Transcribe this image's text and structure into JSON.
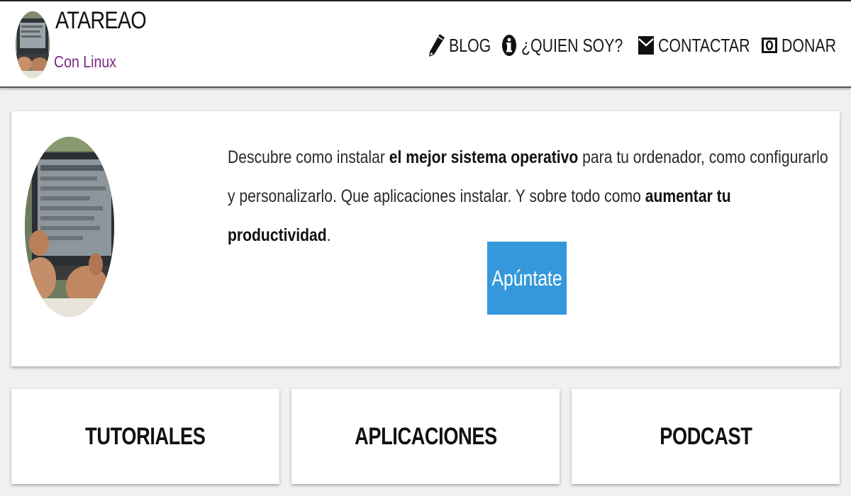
{
  "site": {
    "title": "ATAREAO",
    "tagline": "Con Linux"
  },
  "nav": {
    "items": [
      {
        "label": "BLOG",
        "icon": "pencil-icon"
      },
      {
        "label": "¿QUIEN SOY?",
        "icon": "info-icon"
      },
      {
        "label": "CONTACTAR",
        "icon": "envelope-icon"
      },
      {
        "label": "DONAR",
        "icon": "money-icon"
      }
    ]
  },
  "hero": {
    "text_1": "Descubre como instalar ",
    "bold_1": "el mejor sistema operativo",
    "text_2": " para tu ordenador, como configurarlo y personalizarlo. Que aplicaciones instalar. Y sobre todo como ",
    "bold_2": "aumentar tu productividad",
    "text_3": ".",
    "button_label": "Apúntate",
    "button_color": "#3598db"
  },
  "categories": [
    {
      "label": "TUTORIALES"
    },
    {
      "label": "APLICACIONES"
    },
    {
      "label": "PODCAST"
    }
  ],
  "colors": {
    "tagline": "#7a2a7e",
    "accent": "#3598db"
  }
}
